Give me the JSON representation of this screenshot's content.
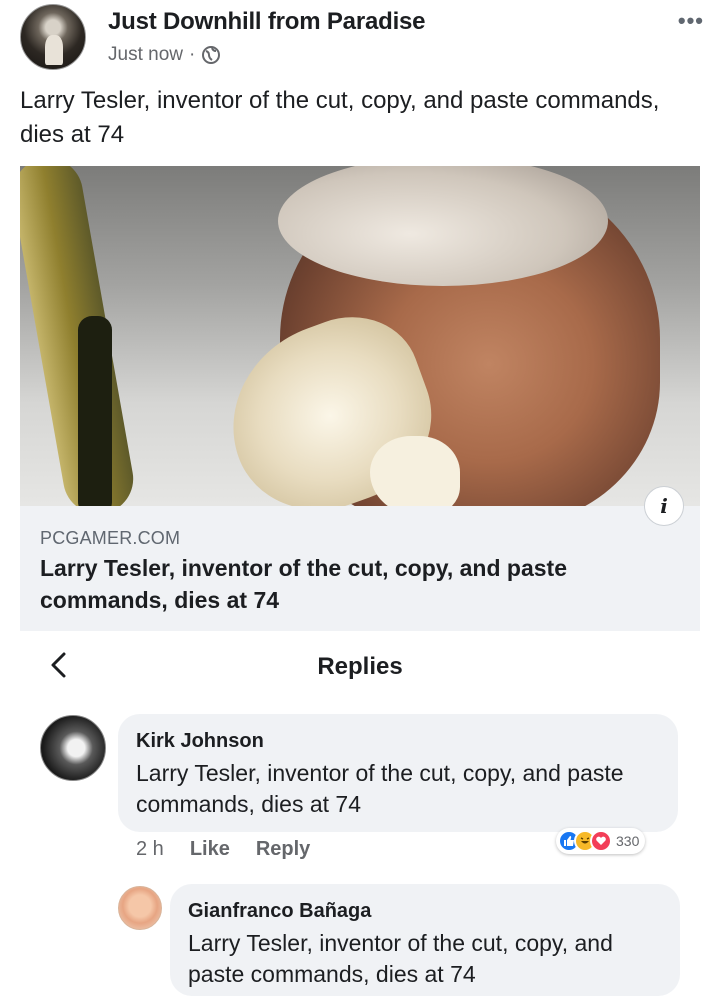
{
  "post": {
    "page_name": "Just Downhill from Paradise",
    "timestamp": "Just now",
    "separator": "·",
    "privacy_icon": "globe-icon",
    "more_icon": "more-options-icon",
    "more_glyph": "•••",
    "text": "Larry Tesler, inventor of the cut, copy, and paste commands, dies at 74"
  },
  "link_preview": {
    "domain": "PCGAMER.COM",
    "title": "Larry Tesler, inventor of the cut, copy, and paste commands, dies at 74",
    "info_glyph": "i"
  },
  "replies": {
    "title": "Replies",
    "comments": [
      {
        "author": "Kirk Johnson",
        "text": "Larry Tesler, inventor of the cut, copy, and paste commands, dies at 74",
        "time": "2 h",
        "like_label": "Like",
        "reply_label": "Reply",
        "reaction_count": "330",
        "reactions": [
          "like",
          "haha",
          "love"
        ]
      },
      {
        "author": "Gianfranco Bañaga",
        "text": "Larry Tesler, inventor of the cut, copy, and paste commands, dies at 74"
      }
    ]
  },
  "colors": {
    "text": "#1c1e21",
    "secondary": "#65676b",
    "bubble": "#f0f2f5",
    "like_blue": "#1877f2",
    "love_red": "#f33e58",
    "haha_yellow": "#f7b928"
  }
}
